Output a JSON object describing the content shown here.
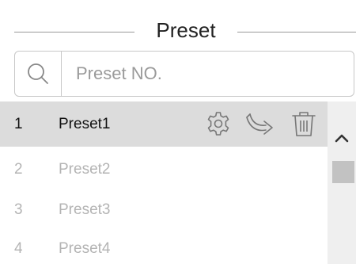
{
  "title": "Preset",
  "search": {
    "placeholder": "Preset NO."
  },
  "presets": [
    {
      "number": "1",
      "name": "Preset1",
      "state": "selected"
    },
    {
      "number": "2",
      "name": "Preset2",
      "state": "disabled"
    },
    {
      "number": "3",
      "name": "Preset3",
      "state": "disabled"
    },
    {
      "number": "4",
      "name": "Preset4",
      "state": "disabled"
    }
  ],
  "row_actions": [
    "gear-icon",
    "call-preset-icon",
    "trash-icon"
  ],
  "colors": {
    "selected_row": "#dcdcdc",
    "disabled_text": "#b4b4b4",
    "icon": "#777777",
    "scroll_thumb": "#c2c2c2"
  }
}
